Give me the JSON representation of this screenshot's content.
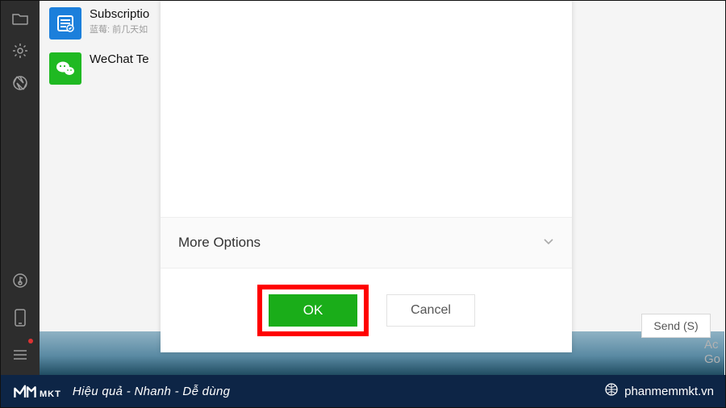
{
  "rail": {
    "icons": [
      "folder-icon",
      "gear-icon",
      "aperture-icon",
      "music-icon",
      "phone-icon",
      "menu-icon"
    ]
  },
  "contacts": [
    {
      "title": "Subscriptio",
      "subtitle": "蓝莓: 前几天如"
    },
    {
      "title": "WeChat Te",
      "subtitle": ""
    }
  ],
  "modal": {
    "more_options_label": "More Options",
    "ok_label": "OK",
    "cancel_label": "Cancel"
  },
  "chat": {
    "send_label": "Send (S)",
    "activate_line1": "Ac",
    "activate_line2": "Go"
  },
  "banner": {
    "logo_text": "MKT",
    "tagline": "Hiệu quả - Nhanh - Dễ dùng",
    "site": "phanmemmkt.vn"
  }
}
